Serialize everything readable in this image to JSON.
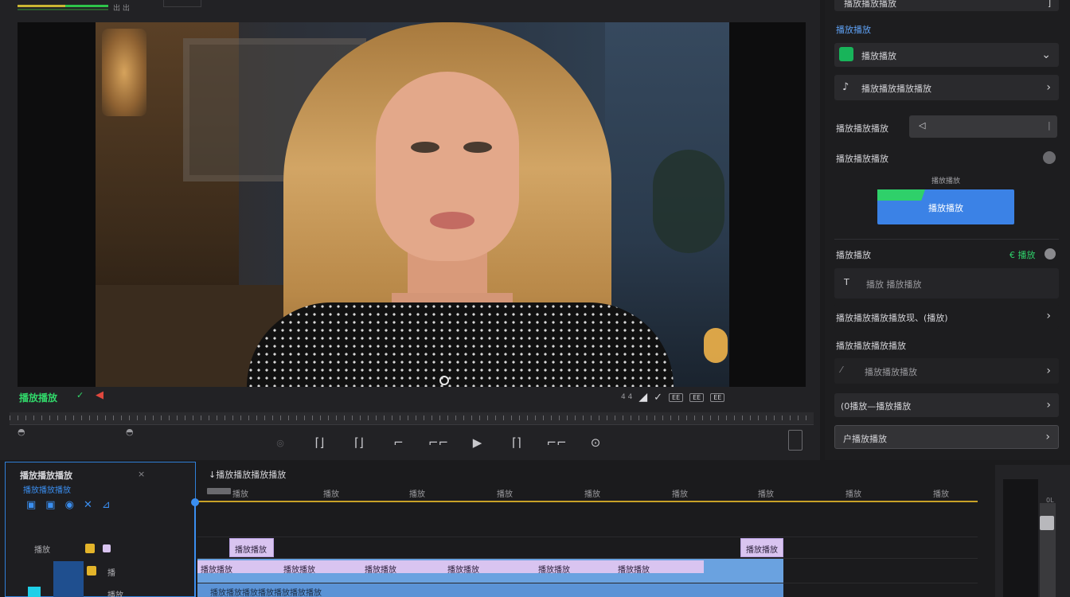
{
  "viewer": {
    "timecode": "播放播放",
    "timecode_suffix": "✓",
    "top_readout": "出 出",
    "controls_right": [
      "4 4",
      "◢",
      "✓"
    ],
    "badges": [
      "EE",
      "EE",
      "EE"
    ],
    "tools": [
      "◎",
      "⌈⌋",
      "⌈⌋",
      "⌐",
      "⌐⌐",
      "▶",
      "⌈⌉",
      "⌐⌐",
      "⊙"
    ]
  },
  "inspector": {
    "top_label": "播放播放播放",
    "section_label": "播放播放",
    "row1_label": "播放播放",
    "row2_label": "播放播放播放播放",
    "slider_label": "播放播放播放",
    "slider_value": "◁",
    "toggle_label": "播放播放播放",
    "preset_caption": "播放播放",
    "preset_button": "播放播放",
    "section2_label": "播放播放",
    "section2_meta": "€ 播放",
    "input_placeholder": "播放 播放播放",
    "row3_label": "播放播放播放播放现、(播放)",
    "section3_label": "播放播放播放播放",
    "row4_label": "播放播放播放",
    "row5_label": "(0播放—播放播放",
    "row6_label": "户播放播放"
  },
  "project": {
    "title": "播放播放播放",
    "close": "×",
    "subtitle": "播放播放播放",
    "track_label": "播放",
    "track_v": "播",
    "track_a": "播放"
  },
  "timeline": {
    "header": "↓播放播放播放播放",
    "ticks": [
      "播放",
      "播放",
      "播放",
      "播放",
      "播放",
      "播放",
      "播放",
      "播放",
      "播放",
      "播放"
    ],
    "label_clip_1": "播放播放",
    "label_clip_2": "播放播放",
    "video_labels": [
      "播放播放",
      "播放播放",
      "播放播放",
      "播放播放",
      "播放播放",
      "播放播放"
    ],
    "audio_label": "播放播放播放播放播放播放播放"
  },
  "meters": {
    "scale": "0L"
  },
  "colors": {
    "accent": "#3b82e6",
    "green": "#2fd06a",
    "clip_lilac": "#d9c4f0",
    "clip_blue": "#6aa2e0",
    "playhead": "#3a8ef0"
  }
}
